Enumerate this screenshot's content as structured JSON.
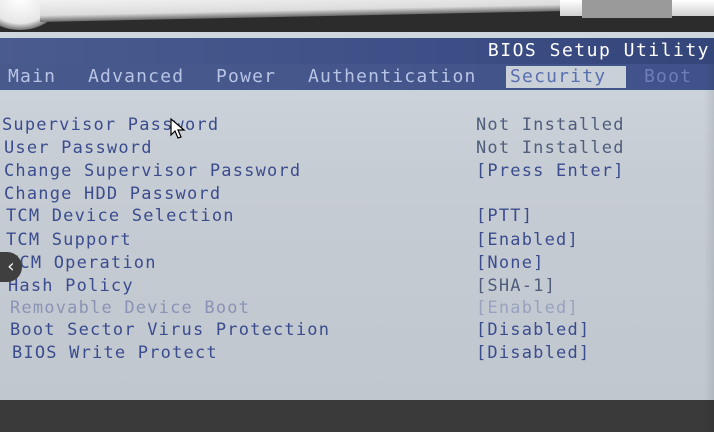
{
  "window": {
    "title": "BIOS Setup Utility"
  },
  "menu": {
    "tabs": [
      {
        "label": "Main",
        "active": false
      },
      {
        "label": "Advanced",
        "active": false
      },
      {
        "label": "Power",
        "active": false
      },
      {
        "label": "Authentication",
        "active": false
      },
      {
        "label": "Security",
        "active": true
      },
      {
        "label": "Boot",
        "active": false
      }
    ]
  },
  "settings": {
    "items": [
      {
        "label": "Supervisor Password",
        "value": "Not Installed"
      },
      {
        "label": "User Password",
        "value": "Not Installed"
      },
      {
        "label": "Change Supervisor Password",
        "value": "[Press Enter]"
      },
      {
        "label": "Change HDD Password",
        "value": ""
      },
      {
        "label": "TCM Device Selection",
        "value": "[PTT]"
      },
      {
        "label": "TCM Support",
        "value": "[Enabled]"
      },
      {
        "label": "TCM Operation",
        "value": "[None]"
      },
      {
        "label": "Hash Policy",
        "value": "[SHA-1]"
      },
      {
        "label": "Removable Device Boot",
        "value": "[Enabled]"
      },
      {
        "label": "Boot Sector Virus Protection",
        "value": "[Disabled]"
      },
      {
        "label": "BIOS Write Protect",
        "value": "[Disabled]"
      }
    ]
  },
  "overlay": {
    "nav_back_icon": "chevron-left-icon"
  },
  "colors": {
    "title_bar": "#3d4f86",
    "screen_bg": "#c6ccd3",
    "text_blue": "#3b4c8e",
    "active_tab_bg": "#c9d0d8"
  }
}
